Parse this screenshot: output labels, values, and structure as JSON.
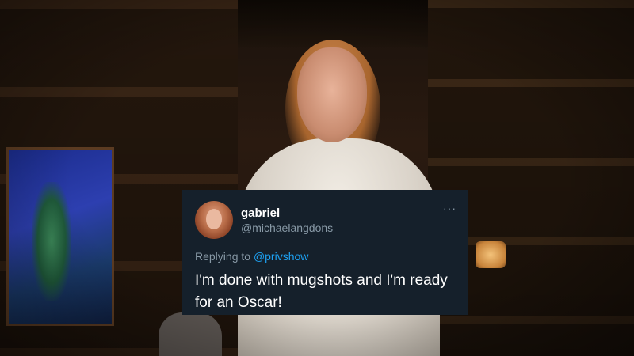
{
  "tweet": {
    "display_name": "gabriel",
    "handle": "@michaelangdons",
    "more_label": "···",
    "replying_prefix": "Replying to ",
    "replying_to": "@privshow",
    "text": "I'm done with mugshots and I'm ready for an Oscar!"
  },
  "colors": {
    "card_background": "#15202b",
    "secondary_text": "#8899a6",
    "link": "#1da1f2"
  },
  "icons": {
    "more": "more-options-icon",
    "avatar": "profile-avatar"
  }
}
